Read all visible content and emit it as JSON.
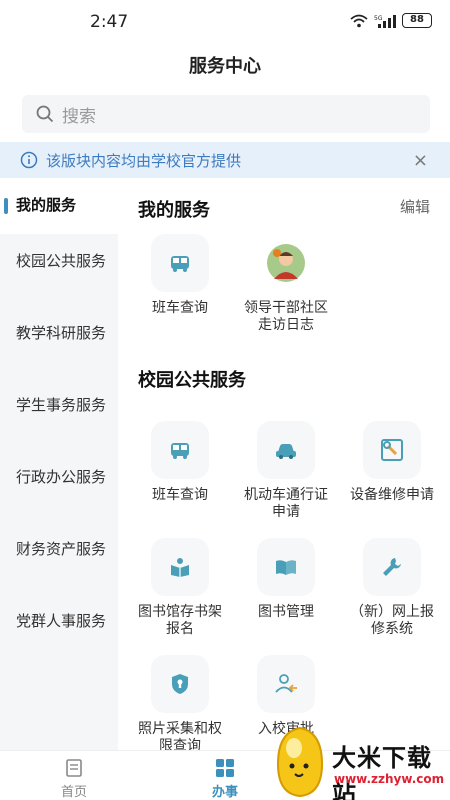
{
  "status": {
    "time": "2:47",
    "battery": "88"
  },
  "header": {
    "title": "服务中心"
  },
  "search": {
    "placeholder": "搜索"
  },
  "notice": {
    "text": "该版块内容均由学校官方提供",
    "close": "×"
  },
  "sidebar": {
    "items": [
      {
        "label": "我的服务"
      },
      {
        "label": "校园公共服务"
      },
      {
        "label": "教学科研服务"
      },
      {
        "label": "学生事务服务"
      },
      {
        "label": "行政办公服务"
      },
      {
        "label": "财务资产服务"
      },
      {
        "label": "党群人事服务"
      }
    ]
  },
  "my_services": {
    "title": "我的服务",
    "edit": "编辑",
    "items": [
      {
        "label": "班车查询",
        "icon": "bus-icon"
      },
      {
        "label": "领导干部社区走访日志",
        "icon": "leader-avatar-icon"
      }
    ]
  },
  "public_services": {
    "title": "校园公共服务",
    "items": [
      {
        "label": "班车查询",
        "icon": "bus-icon"
      },
      {
        "label": "机动车通行证申请",
        "icon": "car-icon"
      },
      {
        "label": "设备维修申请",
        "icon": "repair-tools-icon"
      },
      {
        "label": "图书馆存书架报名",
        "icon": "book-reader-icon"
      },
      {
        "label": "图书管理",
        "icon": "open-book-icon"
      },
      {
        "label": "（新）网上报修系统",
        "icon": "wrench-icon"
      },
      {
        "label": "照片采集和权限查询",
        "icon": "shield-icon"
      },
      {
        "label": "入校审批",
        "icon": "user-entry-icon"
      }
    ]
  },
  "tabbar": {
    "items": [
      {
        "label": "首页",
        "icon": "home-doc-icon"
      },
      {
        "label": "办事",
        "icon": "grid-icon"
      }
    ]
  },
  "watermark": {
    "name": "大米下载站",
    "url": "www.zzhyw.com"
  },
  "colors": {
    "accent": "#3d8fbd",
    "notice_bg": "#e6f0fa",
    "notice_text": "#3d7bc0",
    "icon_teal": "#4a9fb8"
  }
}
